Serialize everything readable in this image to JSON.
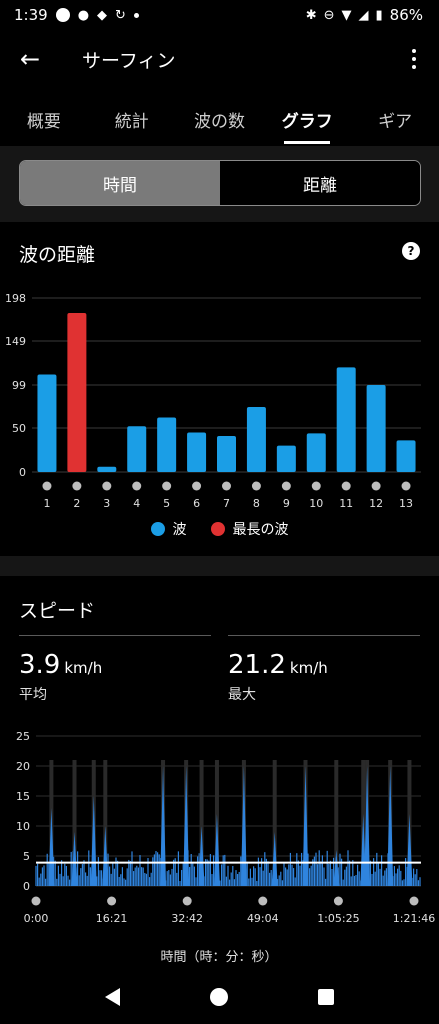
{
  "status": {
    "time": "1:39",
    "battery": "86%"
  },
  "app": {
    "title": "サーフィン"
  },
  "tabs": [
    "概要",
    "統計",
    "波の数",
    "グラフ",
    "ギア"
  ],
  "active_tab": 3,
  "segments": [
    "時間",
    "距離"
  ],
  "active_segment": 0,
  "wave_card": {
    "title": "波の距離",
    "help": "?",
    "legend": [
      "波",
      "最長の波"
    ]
  },
  "speed_card": {
    "title": "スピード",
    "avg_value": "3.9",
    "avg_unit": "km/h",
    "avg_label": "平均",
    "max_value": "21.2",
    "max_unit": "km/h",
    "max_label": "最大",
    "xlabel": "時間（時：分：秒）"
  },
  "colors": {
    "wave": "#1b9ee6",
    "longest": "#e03232",
    "speed": "#2f84de",
    "avg_line": "#ffffff"
  },
  "chart_data": [
    {
      "type": "bar",
      "title": "波の距離",
      "categories": [
        "1",
        "2",
        "3",
        "4",
        "5",
        "6",
        "7",
        "8",
        "9",
        "10",
        "11",
        "12",
        "13"
      ],
      "values": [
        111,
        181,
        6,
        52,
        62,
        45,
        41,
        74,
        30,
        44,
        119,
        99,
        36
      ],
      "highlight_index": 1,
      "yticks": [
        0,
        50,
        99,
        149,
        198
      ],
      "ylim": [
        0,
        198
      ],
      "legend": [
        "波",
        "最長の波"
      ],
      "grid": true
    },
    {
      "type": "area",
      "title": "スピード",
      "xlabel": "時間（時：分：秒）",
      "xticks": [
        "0:00",
        "16:21",
        "32:42",
        "49:04",
        "1:05:25",
        "1:21:46"
      ],
      "yticks": [
        0,
        5,
        10,
        15,
        20,
        25
      ],
      "ylim": [
        0,
        25
      ],
      "average": 3.9,
      "max": 21.2,
      "peaks": [
        {
          "t": 0.04,
          "v": 13
        },
        {
          "t": 0.1,
          "v": 9
        },
        {
          "t": 0.15,
          "v": 15
        },
        {
          "t": 0.18,
          "v": 10
        },
        {
          "t": 0.33,
          "v": 20
        },
        {
          "t": 0.39,
          "v": 20
        },
        {
          "t": 0.43,
          "v": 10
        },
        {
          "t": 0.47,
          "v": 12
        },
        {
          "t": 0.54,
          "v": 20
        },
        {
          "t": 0.62,
          "v": 9
        },
        {
          "t": 0.7,
          "v": 20
        },
        {
          "t": 0.78,
          "v": 6
        },
        {
          "t": 0.85,
          "v": 12
        },
        {
          "t": 0.86,
          "v": 20
        },
        {
          "t": 0.92,
          "v": 20
        },
        {
          "t": 0.97,
          "v": 12
        }
      ]
    }
  ]
}
